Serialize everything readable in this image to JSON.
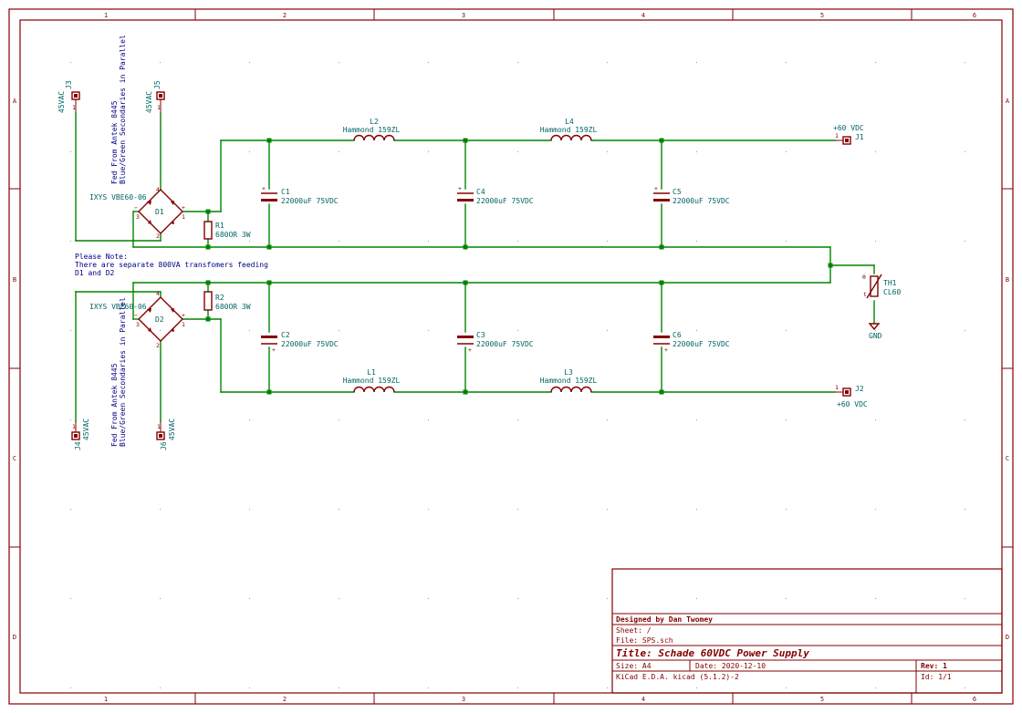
{
  "zones": {
    "columns": [
      "1",
      "2",
      "3",
      "4",
      "5",
      "6"
    ],
    "rows": [
      "A",
      "B",
      "C",
      "D"
    ]
  },
  "components": {
    "J3": {
      "ref": "J3",
      "value": "45VAC"
    },
    "J5": {
      "ref": "J5",
      "value": "45VAC"
    },
    "J4": {
      "ref": "J4",
      "value": "45VAC"
    },
    "J6": {
      "ref": "J6",
      "value": "45VAC"
    },
    "J1": {
      "ref": "J1",
      "value": "+60 VDC"
    },
    "J2": {
      "ref": "J2",
      "value": "+60 VDC"
    },
    "D1": {
      "ref": "D1",
      "value": "IXYS VBE60-06"
    },
    "D2": {
      "ref": "D2",
      "value": "IXYS VBE60-06"
    },
    "R1": {
      "ref": "R1",
      "value": "680OR 3W"
    },
    "R2": {
      "ref": "R2",
      "value": "680OR 3W"
    },
    "C1": {
      "ref": "C1",
      "value": "22000uF 75VDC"
    },
    "C2": {
      "ref": "C2",
      "value": "22000uF 75VDC"
    },
    "C3": {
      "ref": "C3",
      "value": "22000uF 75VDC"
    },
    "C4": {
      "ref": "C4",
      "value": "22000uF 75VDC"
    },
    "C5": {
      "ref": "C5",
      "value": "22000uF 75VDC"
    },
    "C6": {
      "ref": "C6",
      "value": "22000uF 75VDC"
    },
    "L1": {
      "ref": "L1",
      "value": "Hammond 159ZL"
    },
    "L2": {
      "ref": "L2",
      "value": "Hammond 159ZL"
    },
    "L3": {
      "ref": "L3",
      "value": "Hammond 159ZL"
    },
    "L4": {
      "ref": "L4",
      "value": "Hammond 159ZL"
    },
    "TH1": {
      "ref": "TH1",
      "value": "CL60"
    },
    "GND": {
      "value": "GND"
    }
  },
  "notes": {
    "fed_top_1": "Fed From Antek 8445",
    "fed_top_2": "Blue/Green Secondaries in Parallel",
    "fed_bot_1": "Fed From Antek 8445",
    "fed_bot_2": "Blue/Green Secondaries in Parallel",
    "please_1": "Please Note:",
    "please_2": "There are separate 800VA transfomers feeding",
    "please_3": "D1 and D2"
  },
  "pins": {
    "one": "1",
    "two": "2",
    "three": "3",
    "four": "4",
    "plus": "+",
    "minus": "−",
    "theta": "θ",
    "t": "t"
  },
  "title_block": {
    "designer": "Designed by Dan Twomey",
    "sheet": "Sheet: /",
    "file": "File: SPS.sch",
    "title": "Title: Schade 60VDC Power Supply",
    "size": "Size: A4",
    "date": "Date: 2020-12-10",
    "rev": "Rev: 1",
    "tool": "KiCad E.D.A.  kicad (5.1.2)-2",
    "id": "Id: 1/1"
  },
  "colors": {
    "frame": "#840000",
    "wire": "#008400",
    "text": "#006464",
    "note": "#000084"
  }
}
